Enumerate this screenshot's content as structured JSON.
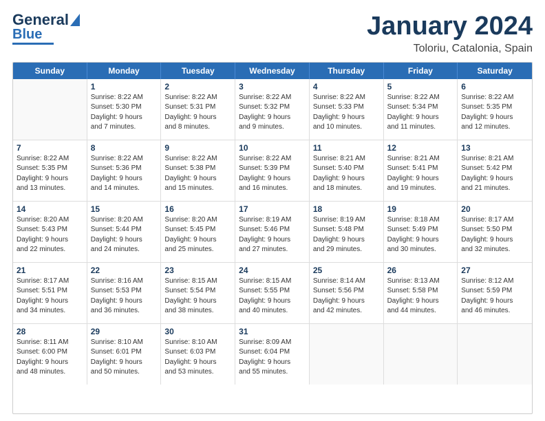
{
  "logo": {
    "line1": "General",
    "line2": "Blue"
  },
  "title": "January 2024",
  "location": "Toloriu, Catalonia, Spain",
  "days": [
    "Sunday",
    "Monday",
    "Tuesday",
    "Wednesday",
    "Thursday",
    "Friday",
    "Saturday"
  ],
  "weeks": [
    [
      {
        "day": "",
        "info": ""
      },
      {
        "day": "1",
        "info": "Sunrise: 8:22 AM\nSunset: 5:30 PM\nDaylight: 9 hours\nand 7 minutes."
      },
      {
        "day": "2",
        "info": "Sunrise: 8:22 AM\nSunset: 5:31 PM\nDaylight: 9 hours\nand 8 minutes."
      },
      {
        "day": "3",
        "info": "Sunrise: 8:22 AM\nSunset: 5:32 PM\nDaylight: 9 hours\nand 9 minutes."
      },
      {
        "day": "4",
        "info": "Sunrise: 8:22 AM\nSunset: 5:33 PM\nDaylight: 9 hours\nand 10 minutes."
      },
      {
        "day": "5",
        "info": "Sunrise: 8:22 AM\nSunset: 5:34 PM\nDaylight: 9 hours\nand 11 minutes."
      },
      {
        "day": "6",
        "info": "Sunrise: 8:22 AM\nSunset: 5:35 PM\nDaylight: 9 hours\nand 12 minutes."
      }
    ],
    [
      {
        "day": "7",
        "info": "Sunrise: 8:22 AM\nSunset: 5:35 PM\nDaylight: 9 hours\nand 13 minutes."
      },
      {
        "day": "8",
        "info": "Sunrise: 8:22 AM\nSunset: 5:36 PM\nDaylight: 9 hours\nand 14 minutes."
      },
      {
        "day": "9",
        "info": "Sunrise: 8:22 AM\nSunset: 5:38 PM\nDaylight: 9 hours\nand 15 minutes."
      },
      {
        "day": "10",
        "info": "Sunrise: 8:22 AM\nSunset: 5:39 PM\nDaylight: 9 hours\nand 16 minutes."
      },
      {
        "day": "11",
        "info": "Sunrise: 8:21 AM\nSunset: 5:40 PM\nDaylight: 9 hours\nand 18 minutes."
      },
      {
        "day": "12",
        "info": "Sunrise: 8:21 AM\nSunset: 5:41 PM\nDaylight: 9 hours\nand 19 minutes."
      },
      {
        "day": "13",
        "info": "Sunrise: 8:21 AM\nSunset: 5:42 PM\nDaylight: 9 hours\nand 21 minutes."
      }
    ],
    [
      {
        "day": "14",
        "info": "Sunrise: 8:20 AM\nSunset: 5:43 PM\nDaylight: 9 hours\nand 22 minutes."
      },
      {
        "day": "15",
        "info": "Sunrise: 8:20 AM\nSunset: 5:44 PM\nDaylight: 9 hours\nand 24 minutes."
      },
      {
        "day": "16",
        "info": "Sunrise: 8:20 AM\nSunset: 5:45 PM\nDaylight: 9 hours\nand 25 minutes."
      },
      {
        "day": "17",
        "info": "Sunrise: 8:19 AM\nSunset: 5:46 PM\nDaylight: 9 hours\nand 27 minutes."
      },
      {
        "day": "18",
        "info": "Sunrise: 8:19 AM\nSunset: 5:48 PM\nDaylight: 9 hours\nand 29 minutes."
      },
      {
        "day": "19",
        "info": "Sunrise: 8:18 AM\nSunset: 5:49 PM\nDaylight: 9 hours\nand 30 minutes."
      },
      {
        "day": "20",
        "info": "Sunrise: 8:17 AM\nSunset: 5:50 PM\nDaylight: 9 hours\nand 32 minutes."
      }
    ],
    [
      {
        "day": "21",
        "info": "Sunrise: 8:17 AM\nSunset: 5:51 PM\nDaylight: 9 hours\nand 34 minutes."
      },
      {
        "day": "22",
        "info": "Sunrise: 8:16 AM\nSunset: 5:53 PM\nDaylight: 9 hours\nand 36 minutes."
      },
      {
        "day": "23",
        "info": "Sunrise: 8:15 AM\nSunset: 5:54 PM\nDaylight: 9 hours\nand 38 minutes."
      },
      {
        "day": "24",
        "info": "Sunrise: 8:15 AM\nSunset: 5:55 PM\nDaylight: 9 hours\nand 40 minutes."
      },
      {
        "day": "25",
        "info": "Sunrise: 8:14 AM\nSunset: 5:56 PM\nDaylight: 9 hours\nand 42 minutes."
      },
      {
        "day": "26",
        "info": "Sunrise: 8:13 AM\nSunset: 5:58 PM\nDaylight: 9 hours\nand 44 minutes."
      },
      {
        "day": "27",
        "info": "Sunrise: 8:12 AM\nSunset: 5:59 PM\nDaylight: 9 hours\nand 46 minutes."
      }
    ],
    [
      {
        "day": "28",
        "info": "Sunrise: 8:11 AM\nSunset: 6:00 PM\nDaylight: 9 hours\nand 48 minutes."
      },
      {
        "day": "29",
        "info": "Sunrise: 8:10 AM\nSunset: 6:01 PM\nDaylight: 9 hours\nand 50 minutes."
      },
      {
        "day": "30",
        "info": "Sunrise: 8:10 AM\nSunset: 6:03 PM\nDaylight: 9 hours\nand 53 minutes."
      },
      {
        "day": "31",
        "info": "Sunrise: 8:09 AM\nSunset: 6:04 PM\nDaylight: 9 hours\nand 55 minutes."
      },
      {
        "day": "",
        "info": ""
      },
      {
        "day": "",
        "info": ""
      },
      {
        "day": "",
        "info": ""
      }
    ]
  ]
}
